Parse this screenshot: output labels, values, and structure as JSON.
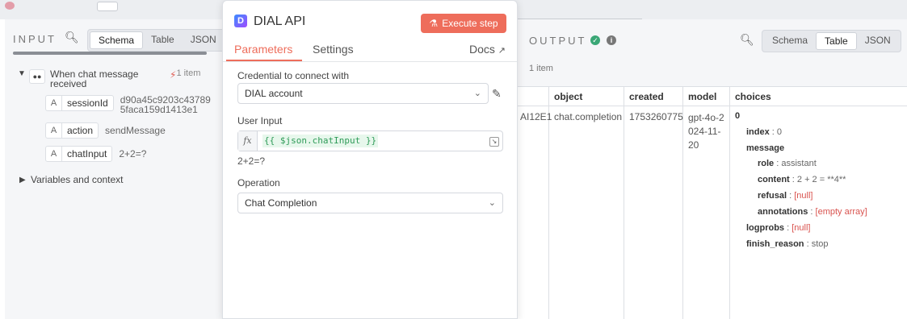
{
  "input": {
    "title": "INPUT",
    "view_options": [
      "Schema",
      "Table",
      "JSON"
    ],
    "active_view": "Schema",
    "node": {
      "name": "When chat message received",
      "items": "1 item"
    },
    "fields": [
      {
        "type": "A",
        "key": "sessionId",
        "value": "d90a45c9203c43789 5faca159d1413e1"
      },
      {
        "type": "A",
        "key": "action",
        "value": "sendMessage"
      },
      {
        "type": "A",
        "key": "chatInput",
        "value": "2+2=?"
      }
    ],
    "variables_label": "Variables and context"
  },
  "modal": {
    "title": "DIAL API",
    "execute_label": "Execute step",
    "tabs": [
      "Parameters",
      "Settings"
    ],
    "active_tab": "Parameters",
    "docs_label": "Docs",
    "credential_label": "Credential to connect with",
    "credential_value": "DIAL account",
    "user_input_label": "User Input",
    "user_input_fx": "fx",
    "user_input_expr": "{{ $json.chatInput }}",
    "user_input_preview": "2+2=?",
    "operation_label": "Operation",
    "operation_value": "Chat Completion"
  },
  "output": {
    "title": "OUTPUT",
    "view_options": [
      "Schema",
      "Table",
      "JSON"
    ],
    "active_view": "Table",
    "items_count": "1 item",
    "columns": [
      "object",
      "created",
      "model",
      "choices"
    ],
    "row": {
      "id_fragment": "AI12E1",
      "object": "chat.completion",
      "created": "1753260775",
      "model": "gpt-4o-2024-11-20"
    },
    "choices_tree": {
      "index_key": "0",
      "index_label": "index",
      "index_value": "0",
      "message_label": "message",
      "role_label": "role",
      "role_value": "assistant",
      "content_label": "content",
      "content_value": "2 + 2 = **4**",
      "refusal_label": "refusal",
      "refusal_value": "[null]",
      "annotations_label": "annotations",
      "annotations_value": "[empty array]",
      "logprobs_label": "logprobs",
      "logprobs_value": "[null]",
      "finish_reason_label": "finish_reason",
      "finish_reason_value": "stop"
    }
  },
  "colors": {
    "accent": "#ee6d5b",
    "success": "#3aa776",
    "error": "#d9534f"
  }
}
